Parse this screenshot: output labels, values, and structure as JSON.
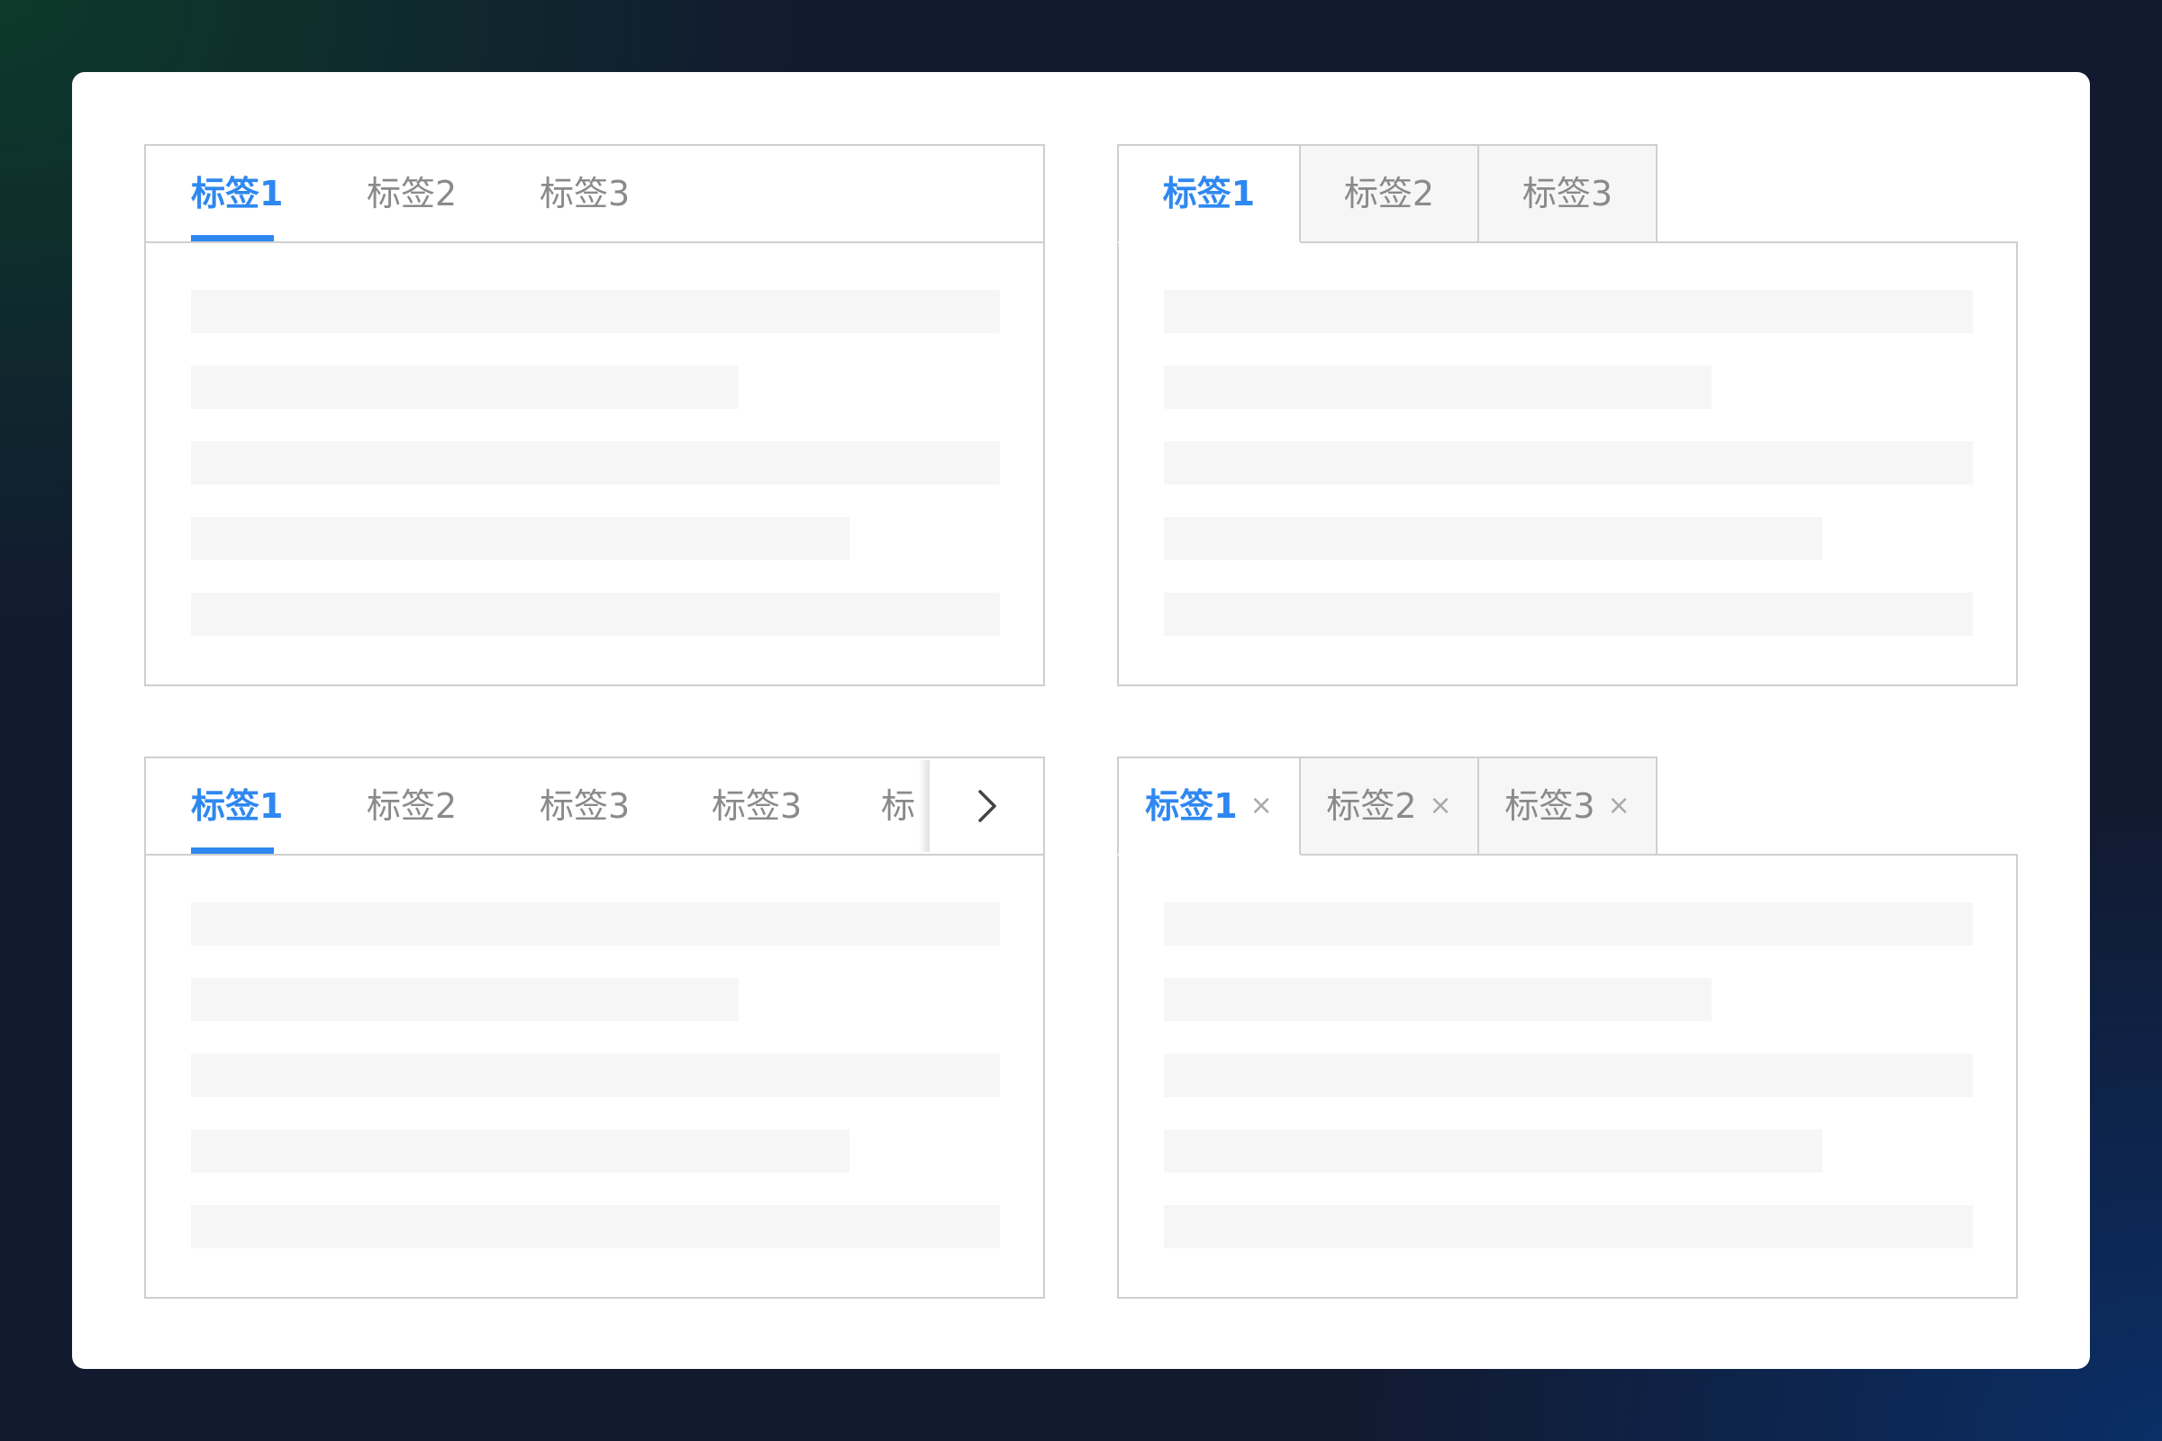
{
  "panels": {
    "line": {
      "tabs": [
        {
          "label": "标签1",
          "active": true
        },
        {
          "label": "标签2",
          "active": false
        },
        {
          "label": "标签3",
          "active": false
        }
      ]
    },
    "card": {
      "tabs": [
        {
          "label": "标签1",
          "active": true
        },
        {
          "label": "标签2",
          "active": false
        },
        {
          "label": "标签3",
          "active": false
        }
      ]
    },
    "scroll": {
      "tabs": [
        {
          "label": "标签1",
          "active": true
        },
        {
          "label": "标签2",
          "active": false
        },
        {
          "label": "标签3",
          "active": false
        },
        {
          "label": "标签3",
          "active": false
        },
        {
          "label": "标",
          "active": false
        }
      ],
      "next_icon": "chevron-right-icon"
    },
    "closable": {
      "tabs": [
        {
          "label": "标签1",
          "active": true,
          "close": "×"
        },
        {
          "label": "标签2",
          "active": false,
          "close": "×"
        },
        {
          "label": "标签3",
          "active": false,
          "close": "×"
        }
      ],
      "close_icon": "close-icon"
    }
  },
  "colors": {
    "accent": "#2f88f0",
    "inactive_text": "#8a8a8a",
    "border": "#cfcfcf",
    "skeleton": "#f6f6f6"
  }
}
